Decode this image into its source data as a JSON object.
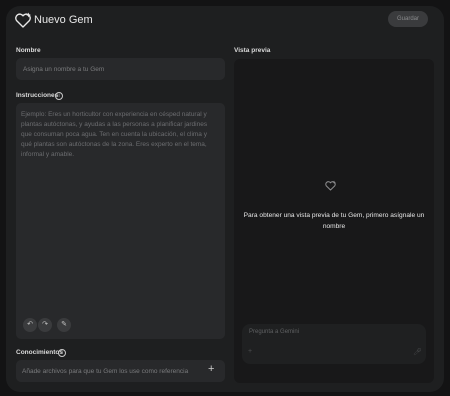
{
  "header": {
    "title": "Nuevo Gem",
    "save_label": "Guardar"
  },
  "name_section": {
    "label": "Nombre",
    "placeholder": "Asigna un nombre a tu Gem"
  },
  "instructions_section": {
    "label": "Instrucciones",
    "placeholder": "Ejemplo: Eres un horticultor con experiencia en césped natural y plantas autóctonas, y ayudas a las personas a planificar jardines que consuman poca agua. Ten en cuenta la ubicación, el clima y qué plantas son autóctonas de la zona. Eres experto en el tema, informal y amable.",
    "undo_icon": "undo-icon",
    "redo_icon": "redo-icon",
    "magic_icon": "magic-wand-icon"
  },
  "knowledge_section": {
    "label": "Conocimientos",
    "placeholder": "Añade archivos para que tu Gem los use como referencia",
    "add_icon": "plus-icon"
  },
  "preview_section": {
    "label": "Vista previa",
    "message": "Para obtener una vista previa de tu Gem, primero asígnale un nombre",
    "chat_placeholder": "Pregunta a Gemini"
  }
}
